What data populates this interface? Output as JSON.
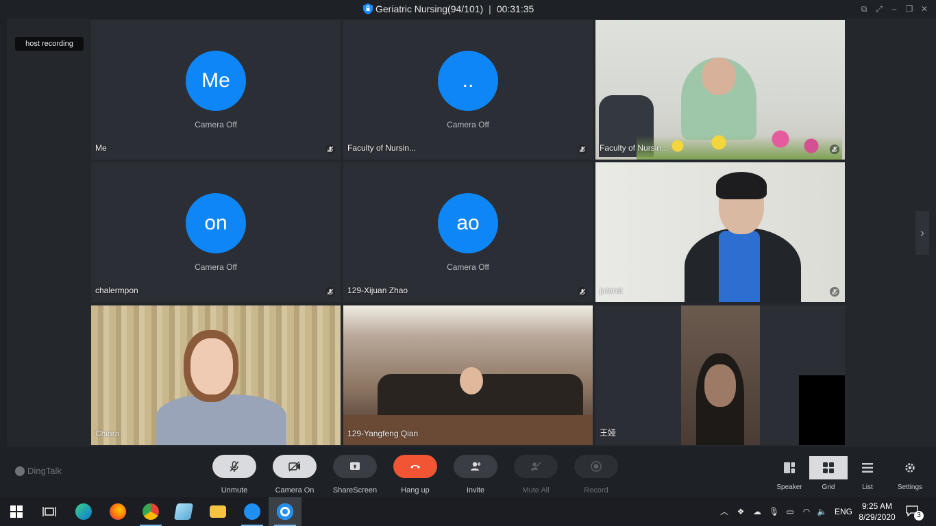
{
  "window": {
    "title": "Geriatric Nursing(94/101)",
    "separator": "|",
    "elapsed": "00:31:35"
  },
  "recording_badge": "host recording",
  "tiles": [
    {
      "name": "Me",
      "avatar_text": "Me",
      "camera_status": "Camera Off"
    },
    {
      "name": "Faculty of Nursin...",
      "avatar_text": "..",
      "camera_status": "Camera Off"
    },
    {
      "name": "Faculty of Nursin..."
    },
    {
      "name": "chalermpon",
      "avatar_text": "on",
      "camera_status": "Camera Off"
    },
    {
      "name": "129-Xijuan Zhao",
      "avatar_text": "ao",
      "camera_status": "Camera Off"
    },
    {
      "name": "jutarat"
    },
    {
      "name": "Chiara"
    },
    {
      "name": "129-Yangfeng Qian"
    },
    {
      "name": "王娅"
    }
  ],
  "brand": "DingTalk",
  "toolbar": {
    "unmute": "Unmute",
    "camera_on": "Camera On",
    "share_screen": "ShareScreen",
    "hang_up": "Hang up",
    "invite": "Invite",
    "mute_all": "Mute All",
    "record": "Record"
  },
  "views": {
    "speaker": "Speaker",
    "grid": "Grid",
    "list": "List",
    "settings": "Settings"
  },
  "taskbar": {
    "language": "ENG",
    "time": "9:25 AM",
    "date": "8/29/2020",
    "notification_count": "3"
  },
  "colors": {
    "avatar": "#0f86f5",
    "hangup": "#f25533",
    "background": "#1e2126"
  }
}
